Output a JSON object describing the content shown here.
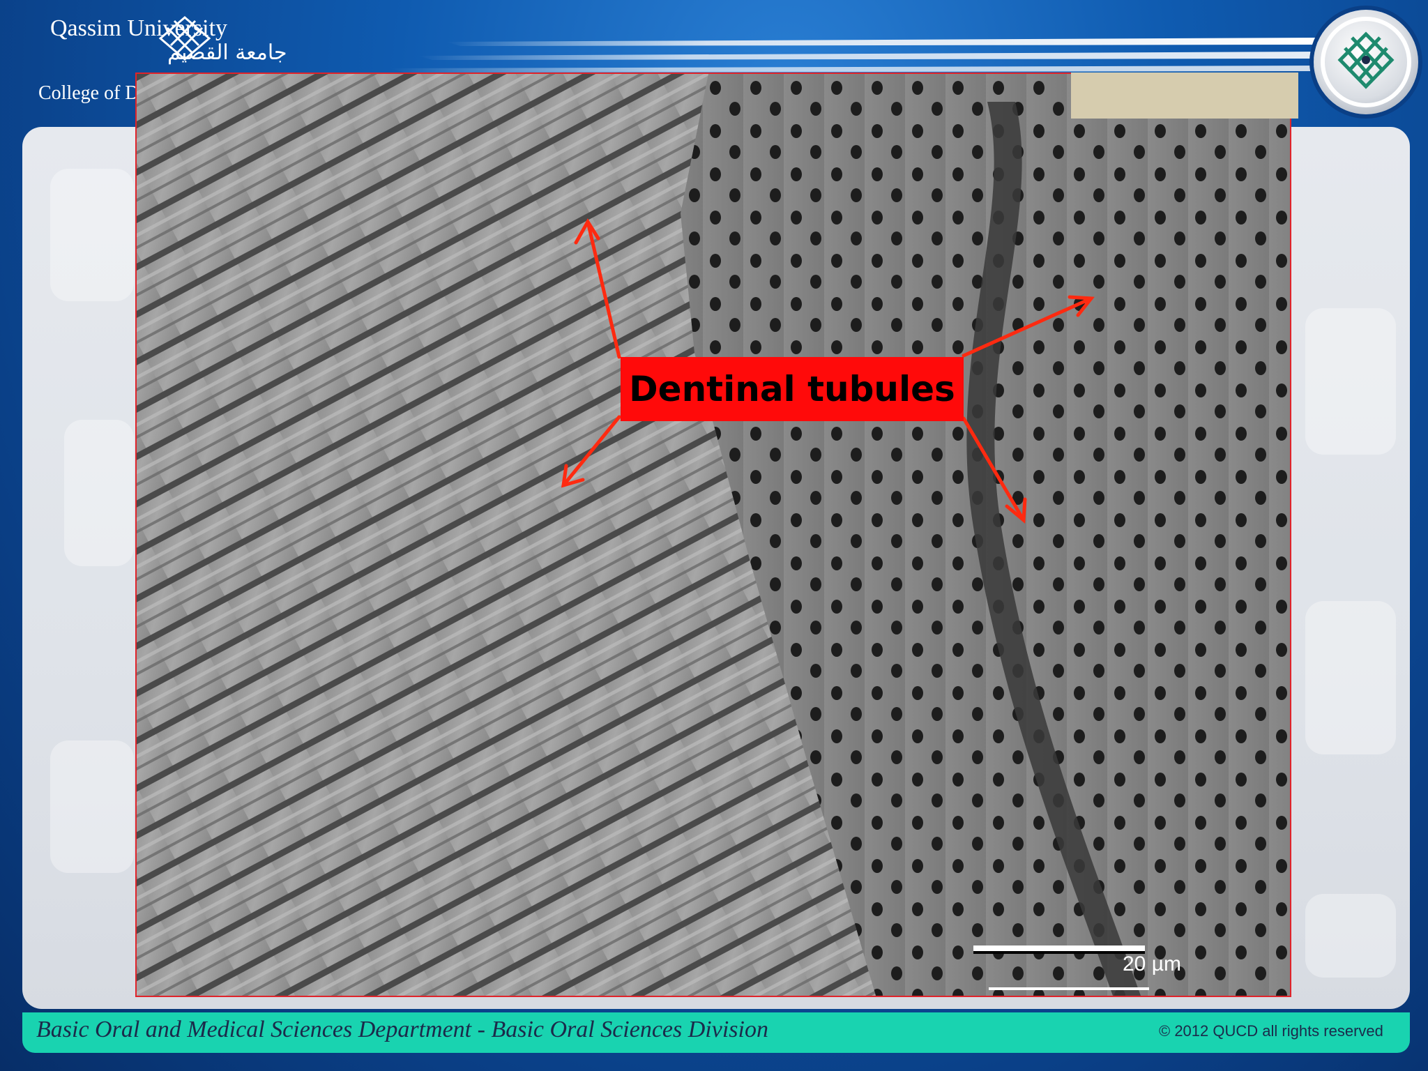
{
  "header": {
    "university_en": "Qassim University",
    "university_ar": "جامعة القصيم",
    "college": "College of De"
  },
  "figure": {
    "label": "Dentinal tubules",
    "scale_bar": "20 µm"
  },
  "footer": {
    "department": "Basic Oral and Medical Sciences Department - Basic Oral Sciences Division",
    "copyright": "© 2012 QUCD all rights reserved"
  },
  "colors": {
    "label_bg": "#ff0a0a",
    "arrow": "#ff2a10",
    "frame": "#e0232a",
    "footer_bg": "#19d3b0"
  },
  "icons": [
    "qassim-logo-icon",
    "university-seal-icon"
  ]
}
